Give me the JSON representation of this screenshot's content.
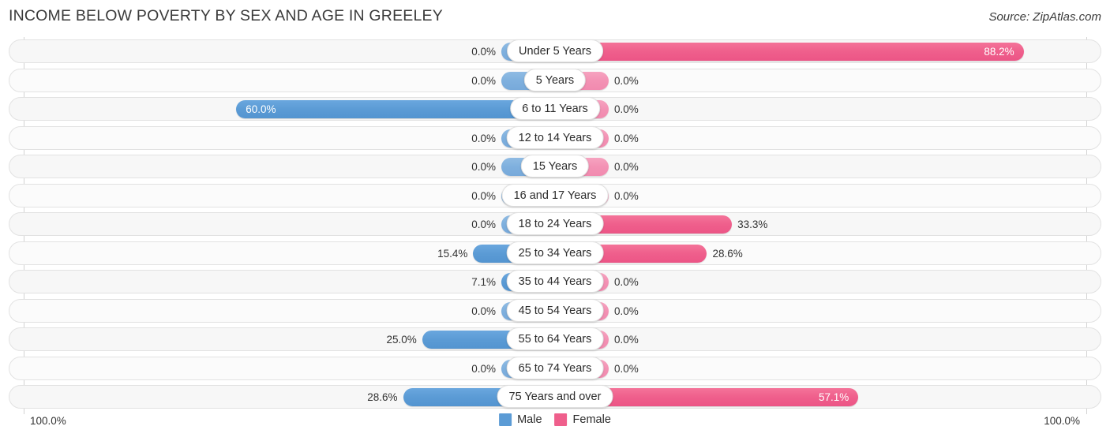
{
  "header": {
    "title": "INCOME BELOW POVERTY BY SEX AND AGE IN GREELEY",
    "source": "Source: ZipAtlas.com"
  },
  "axis": {
    "left_label": "100.0%",
    "right_label": "100.0%",
    "max": 100.0
  },
  "legend": {
    "items": [
      {
        "label": "Male",
        "color": "#5b9bd5",
        "icon": "square-swatch-icon"
      },
      {
        "label": "Female",
        "color": "#ef5f8c",
        "icon": "square-swatch-icon"
      }
    ]
  },
  "chart_data": {
    "type": "bar",
    "subtype": "diverging-bidirectional",
    "title": "INCOME BELOW POVERTY BY SEX AND AGE IN GREELEY",
    "xlabel": "",
    "ylabel": "",
    "xlim": [
      100.0,
      100.0
    ],
    "grid": true,
    "legend_position": "bottom-center",
    "categories": [
      "Under 5 Years",
      "5 Years",
      "6 to 11 Years",
      "12 to 14 Years",
      "15 Years",
      "16 and 17 Years",
      "18 to 24 Years",
      "25 to 34 Years",
      "35 to 44 Years",
      "45 to 54 Years",
      "55 to 64 Years",
      "65 to 74 Years",
      "75 Years and over"
    ],
    "series": [
      {
        "name": "Male",
        "color": "#5b9bd5",
        "direction": "left",
        "values": [
          0.0,
          0.0,
          60.0,
          0.0,
          0.0,
          0.0,
          0.0,
          15.4,
          7.1,
          0.0,
          25.0,
          0.0,
          28.6
        ],
        "labels": [
          "0.0%",
          "0.0%",
          "60.0%",
          "0.0%",
          "0.0%",
          "0.0%",
          "0.0%",
          "15.4%",
          "7.1%",
          "0.0%",
          "25.0%",
          "0.0%",
          "28.6%"
        ]
      },
      {
        "name": "Female",
        "color": "#ef5f8c",
        "direction": "right",
        "values": [
          88.2,
          0.0,
          0.0,
          0.0,
          0.0,
          0.0,
          33.3,
          28.6,
          0.0,
          0.0,
          0.0,
          0.0,
          57.1
        ],
        "labels": [
          "88.2%",
          "0.0%",
          "0.0%",
          "0.0%",
          "0.0%",
          "0.0%",
          "33.3%",
          "28.6%",
          "0.0%",
          "0.0%",
          "0.0%",
          "0.0%",
          "57.1%"
        ]
      }
    ]
  }
}
